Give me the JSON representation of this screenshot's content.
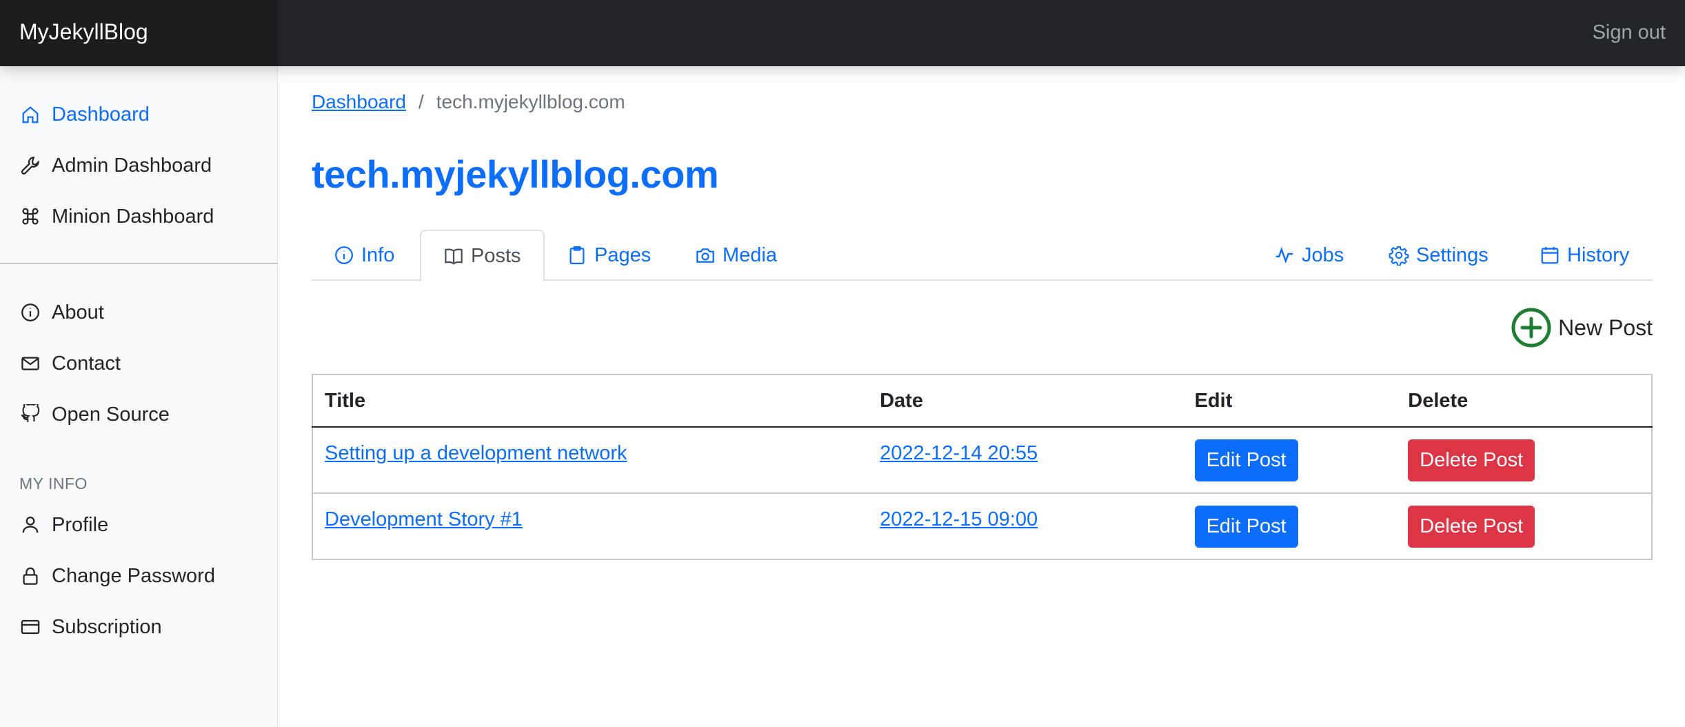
{
  "navbar": {
    "brand": "MyJekyllBlog",
    "signout": "Sign out"
  },
  "sidebar": {
    "primary_items": [
      {
        "label": "Dashboard",
        "icon": "home-icon",
        "active": true
      },
      {
        "label": "Admin Dashboard",
        "icon": "wrench-icon",
        "active": false
      },
      {
        "label": "Minion Dashboard",
        "icon": "command-icon",
        "active": false
      }
    ],
    "secondary_items": [
      {
        "label": "About",
        "icon": "info-circle-icon"
      },
      {
        "label": "Contact",
        "icon": "envelope-icon"
      },
      {
        "label": "Open Source",
        "icon": "github-icon"
      }
    ],
    "section_heading": "MY INFO",
    "info_items": [
      {
        "label": "Profile",
        "icon": "person-icon"
      },
      {
        "label": "Change Password",
        "icon": "lock-icon"
      },
      {
        "label": "Subscription",
        "icon": "credit-card-icon"
      }
    ]
  },
  "breadcrumb": {
    "root": "Dashboard",
    "separator": "/",
    "current": "tech.myjekyllblog.com"
  },
  "page_title": "tech.myjekyllblog.com",
  "tabs": {
    "left": [
      {
        "label": "Info",
        "icon": "info-circle-icon",
        "active": false
      },
      {
        "label": "Posts",
        "icon": "book-icon",
        "active": true
      },
      {
        "label": "Pages",
        "icon": "clipboard-icon",
        "active": false
      },
      {
        "label": "Media",
        "icon": "camera-icon",
        "active": false
      }
    ],
    "right": [
      {
        "label": "Jobs",
        "icon": "activity-icon"
      },
      {
        "label": "Settings",
        "icon": "gear-icon"
      },
      {
        "label": "History",
        "icon": "calendar-icon"
      }
    ]
  },
  "new_post": {
    "label": "New Post",
    "icon": "plus-circle-icon"
  },
  "table": {
    "headers": [
      "Title",
      "Date",
      "Edit",
      "Delete"
    ],
    "rows": [
      {
        "title": "Setting up a development network",
        "date": "2022-12-14 20:55",
        "edit": "Edit Post",
        "delete": "Delete Post"
      },
      {
        "title": "Development Story #1",
        "date": "2022-12-15 09:00",
        "edit": "Edit Post",
        "delete": "Delete Post"
      }
    ]
  },
  "colors": {
    "navbar_bg": "#212529",
    "accent": "#0d6efd",
    "danger": "#dc3545",
    "success": "#1e7e34",
    "sidebar_bg": "#f8f9fa"
  }
}
